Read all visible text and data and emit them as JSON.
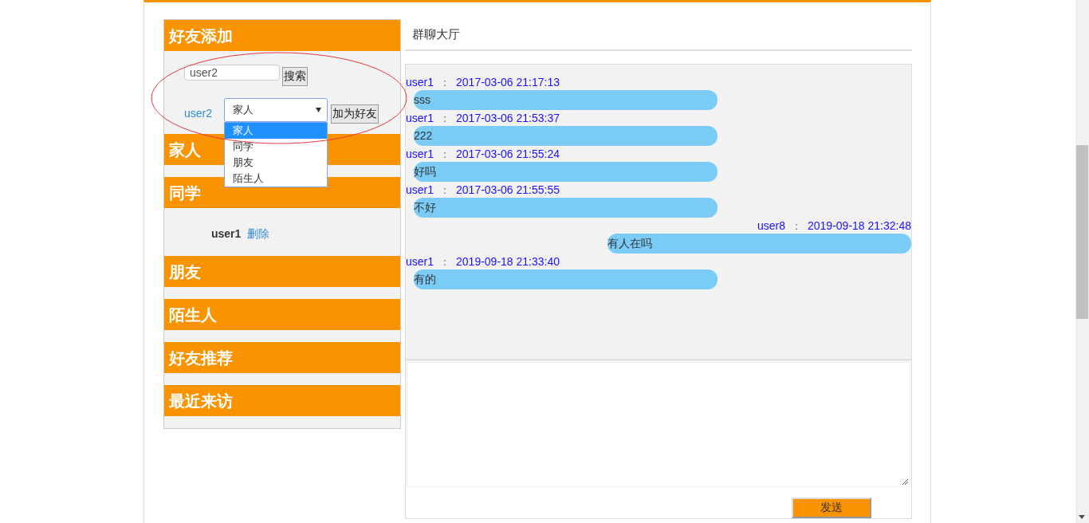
{
  "add_friend": {
    "title": "好友添加",
    "search_value": "user2",
    "search_button": "搜索",
    "result_name": "user2",
    "group_select": {
      "value": "家人",
      "expanded": true,
      "options": [
        {
          "label": "家人",
          "selected": true
        },
        {
          "label": "同学",
          "selected": false
        },
        {
          "label": "朋友",
          "selected": false
        },
        {
          "label": "陌生人",
          "selected": false
        }
      ]
    },
    "add_button": "加为好友"
  },
  "groups": [
    {
      "title": "家人"
    },
    {
      "title": "同学",
      "friends": [
        {
          "name": "user1",
          "action": "删除"
        }
      ]
    },
    {
      "title": "朋友"
    },
    {
      "title": "陌生人"
    },
    {
      "title": "好友推荐"
    },
    {
      "title": "最近来访"
    }
  ],
  "chat": {
    "title": "群聊大厅",
    "messages": [
      {
        "kind": "received",
        "user": "user1",
        "sep": "：",
        "time": "2017-03-06 21:17:13",
        "text": "sss"
      },
      {
        "kind": "received",
        "user": "user1",
        "sep": "：",
        "time": "2017-03-06 21:53:37",
        "text": "222"
      },
      {
        "kind": "received",
        "user": "user1",
        "sep": "：",
        "time": "2017-03-06 21:55:24",
        "text": "好吗"
      },
      {
        "kind": "received",
        "user": "user1",
        "sep": "：",
        "time": "2017-03-06 21:55:55",
        "text": "不好"
      },
      {
        "kind": "sent",
        "user": "user8",
        "sep": "：",
        "time": "2019-09-18 21:32:48",
        "text": "有人在吗"
      },
      {
        "kind": "received",
        "user": "user1",
        "sep": "：",
        "time": "2019-09-18 21:33:40",
        "text": "有的"
      }
    ],
    "send_button": "发送"
  }
}
